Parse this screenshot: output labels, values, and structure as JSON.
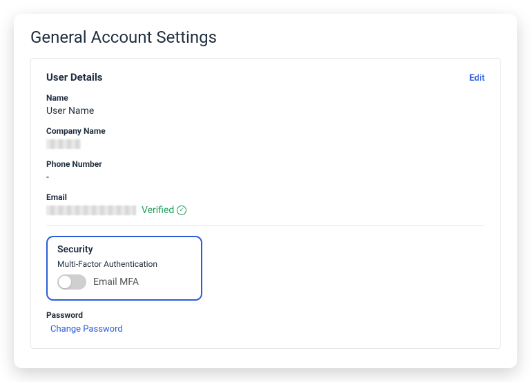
{
  "page": {
    "title": "General Account Settings"
  },
  "userDetails": {
    "sectionTitle": "User Details",
    "editLabel": "Edit",
    "name": {
      "label": "Name",
      "value": "User Name"
    },
    "company": {
      "label": "Company Name",
      "value": ""
    },
    "phone": {
      "label": "Phone Number",
      "value": "-"
    },
    "email": {
      "label": "Email",
      "value": "",
      "verifiedLabel": "Verified"
    }
  },
  "security": {
    "sectionTitle": "Security",
    "mfaLabel": "Multi-Factor Authentication",
    "mfaTypeLabel": "Email MFA",
    "mfaEnabled": false
  },
  "password": {
    "label": "Password",
    "changeLabel": "Change Password"
  }
}
